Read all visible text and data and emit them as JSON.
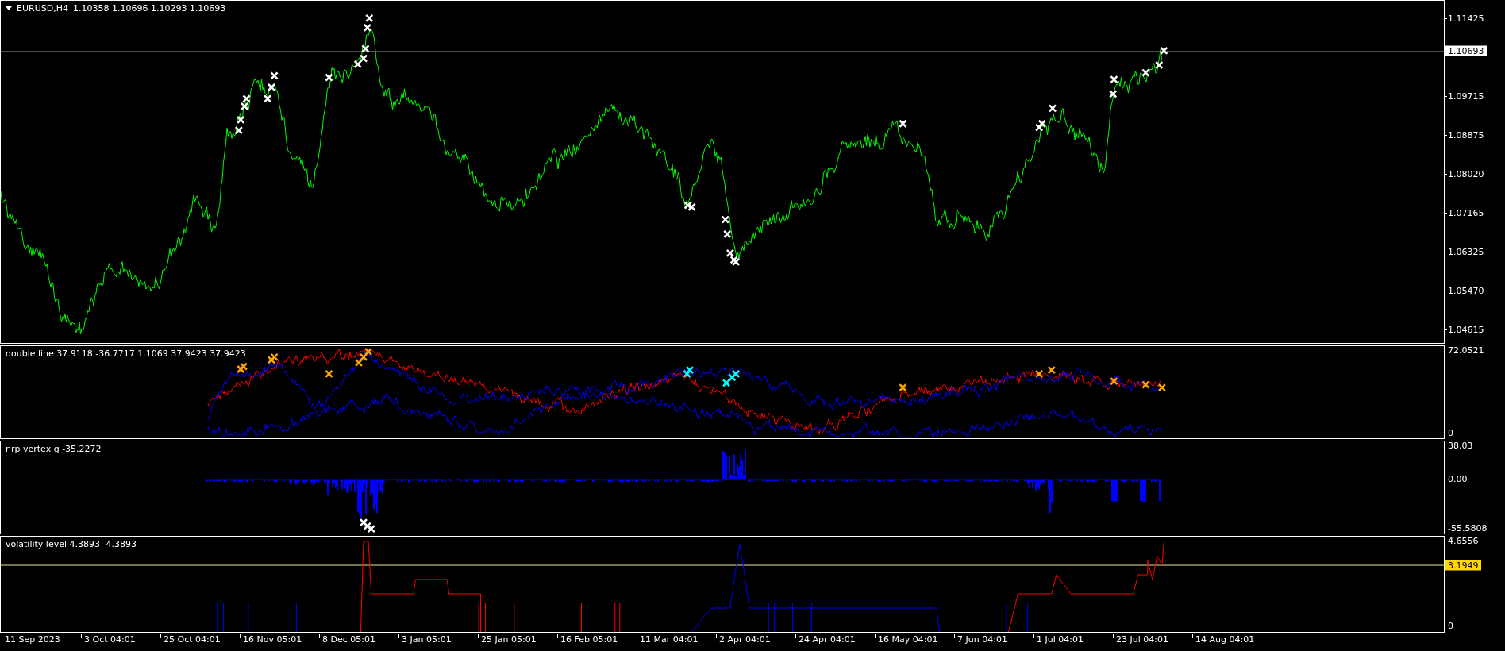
{
  "chart": {
    "symbol": "EURUSD,H4",
    "ohlc": "1.10358 1.10696 1.10293 1.10693",
    "price_axis": [
      "1.11425",
      "1.09715",
      "1.08875",
      "1.08020",
      "1.07165",
      "1.06325",
      "1.05470",
      "1.04615"
    ],
    "current_price": "1.10693"
  },
  "indicators": [
    {
      "kind": "lines",
      "label": "double line 37.9118 -36.7717 1.1069 37.9423 37.9423",
      "axis": [
        "72.0521",
        "0"
      ]
    },
    {
      "kind": "histogram",
      "label": "nrp vertex g -35.2272",
      "axis": [
        "38.03",
        "0.00",
        "-55.5808"
      ]
    },
    {
      "kind": "steps",
      "label": "volatility level 4.3893 -4.3893",
      "axis": [
        "4.6556",
        "0"
      ],
      "level_badge": "3.1949"
    }
  ],
  "time_axis": [
    "11 Sep 2023",
    "3 Oct 04:01",
    "25 Oct 04:01",
    "16 Nov 05:01",
    "8 Dec 05:01",
    "3 Jan 05:01",
    "25 Jan 05:01",
    "16 Feb 05:01",
    "11 Mar 04:01",
    "2 Apr 04:01",
    "24 Apr 04:01",
    "16 May 04:01",
    "7 Jun 04:01",
    "1 Jul 04:01",
    "23 Jul 04:01",
    "14 Aug 04:01"
  ]
}
